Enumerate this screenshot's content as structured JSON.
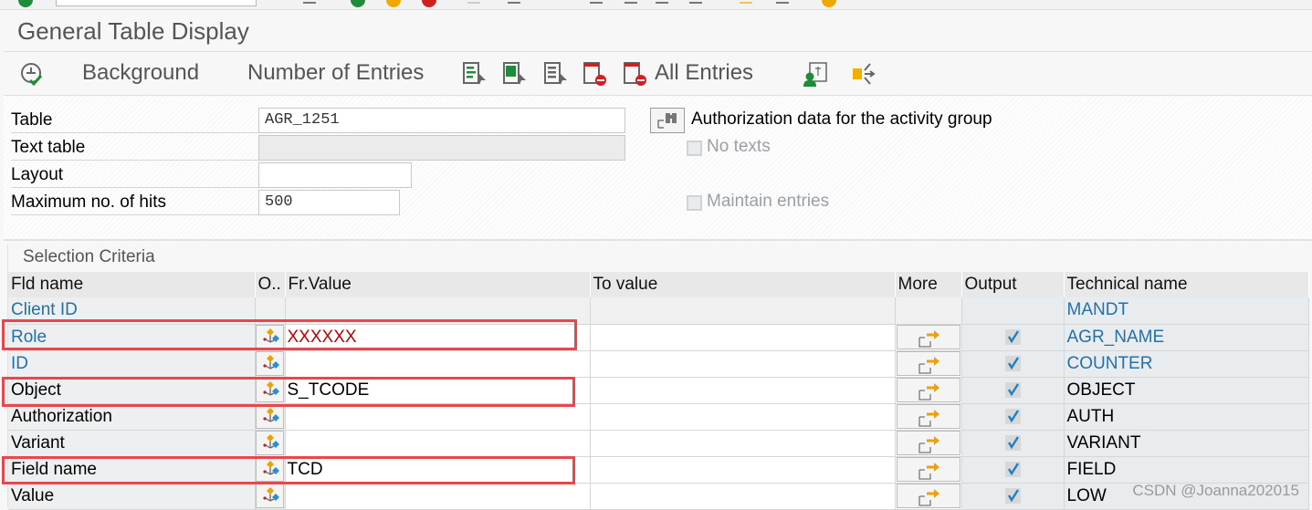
{
  "window": {
    "title": "General Table Display"
  },
  "toolbar": {
    "background_label": "Background",
    "number_of_entries_label": "Number of Entries",
    "all_entries_label": "All Entries"
  },
  "header": {
    "table_label": "Table",
    "table_value": "AGR_1251",
    "text_table_label": "Text table",
    "text_table_value": "",
    "layout_label": "Layout",
    "layout_value": "",
    "max_hits_label": "Maximum no. of hits",
    "max_hits_value": "500",
    "table_description": "Authorization data for the activity group",
    "no_texts_label": "No texts",
    "maintain_entries_label": "Maintain entries"
  },
  "selection": {
    "title": "Selection Criteria",
    "columns": [
      "Fld name",
      "O..",
      "Fr.Value",
      "To value",
      "More",
      "Output",
      "Technical name"
    ],
    "rows": [
      {
        "name": "Client ID",
        "from": "",
        "to": "",
        "tech": "MANDT",
        "link": true,
        "editable": false,
        "output": null
      },
      {
        "name": "Role",
        "from": "XXXXXX",
        "to": "",
        "tech": "AGR_NAME",
        "link": true,
        "editable": true,
        "output": true
      },
      {
        "name": "ID",
        "from": "",
        "to": "",
        "tech": "COUNTER",
        "link": true,
        "editable": true,
        "output": true
      },
      {
        "name": "Object",
        "from": "S_TCODE",
        "to": "",
        "tech": "OBJECT",
        "link": false,
        "editable": true,
        "output": true
      },
      {
        "name": "Authorization",
        "from": "",
        "to": "",
        "tech": "AUTH",
        "link": false,
        "editable": true,
        "output": true
      },
      {
        "name": "Variant",
        "from": "",
        "to": "",
        "tech": "VARIANT",
        "link": false,
        "editable": true,
        "output": true
      },
      {
        "name": "Field name",
        "from": "TCD",
        "to": "",
        "tech": "FIELD",
        "link": false,
        "editable": true,
        "output": true
      },
      {
        "name": "Value",
        "from": "",
        "to": "",
        "tech": "LOW",
        "link": false,
        "editable": true,
        "output": true
      }
    ]
  },
  "watermark": "CSDN @Joanna202015",
  "colors": {
    "highlight": "#e8474e",
    "link": "#2470a8",
    "error_value": "#c00000"
  }
}
